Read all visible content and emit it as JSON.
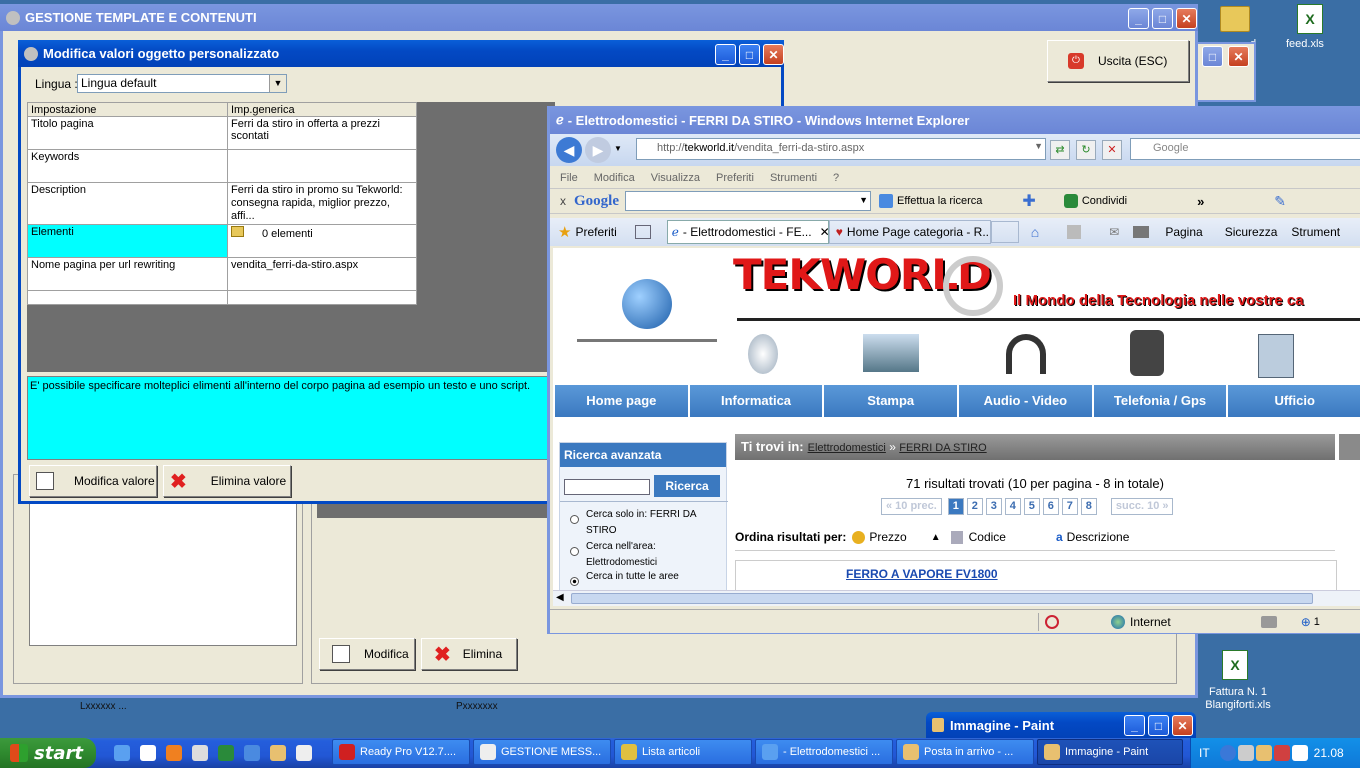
{
  "desktop": {
    "icon1_label": "feed.xls",
    "icon1_partial": "d",
    "icon2_label": "Fattura N. 1 Blangiforti.xls"
  },
  "back_window": {
    "title": "GESTIONE TEMPLATE E CONTENUTI",
    "exit_label": "Uscita (ESC)",
    "modify_label": "Modifica",
    "delete_label": "Elimina",
    "behind_text_left": "Lxxxxxx ...",
    "behind_text_right": "Pxxxxxxx"
  },
  "dialog": {
    "title": "Modifica valori oggetto personalizzato",
    "language_label": "Lingua :",
    "language_value": "Lingua default",
    "grid": {
      "headers": [
        "Impostazione",
        "Imp.generica"
      ],
      "rows": [
        {
          "key": "Titolo pagina",
          "value": "Ferri da stiro in offerta a prezzi scontati"
        },
        {
          "key": "Keywords",
          "value": ""
        },
        {
          "key": "Description",
          "value": "Ferri da stiro in promo su Tekworld: consegna rapida, miglior prezzo, affi..."
        },
        {
          "key": "Elementi",
          "value": "0 elementi"
        },
        {
          "key": "Nome pagina per url rewriting",
          "value": "vendita_ferri-da-stiro.aspx"
        },
        {
          "key": "",
          "value": ""
        }
      ]
    },
    "info_text": "E' possibile specificare molteplici elimenti all'interno del corpo pagina ad esempio un testo e uno script.",
    "modify_value_label": "Modifica valore",
    "delete_value_label": "Elimina valore"
  },
  "ie": {
    "title": "- Elettrodomestici - FERRI DA STIRO - Windows Internet Explorer",
    "address": "http://tekworld.it/vendita_ferri-da-stiro.aspx",
    "address_host": "http://",
    "address_domain": "tekworld.it",
    "address_path": "/vendita_ferri-da-stiro.aspx",
    "search_placeholder": "Google",
    "menu": [
      "File",
      "Modifica",
      "Visualizza",
      "Preferiti",
      "Strumenti",
      "?"
    ],
    "toolbar": {
      "x": "x",
      "google": "Google",
      "search_btn": "Effettua la ricerca",
      "share": "Condividi",
      "more": "»"
    },
    "fav_label": "Preferiti",
    "tab1": "- Elettrodomestici - FE...",
    "tab2": "Home Page categoria - R...",
    "cmd": {
      "page": "Pagina",
      "security": "Sicurezza",
      "tools": "Strument"
    },
    "status_zone": "Internet",
    "status_zoom": "1"
  },
  "site": {
    "logo": "TEKWORLD",
    "tagline": "Il Mondo della Tecnologia nelle vostre ca",
    "nav": [
      "Home page",
      "Informatica",
      "Stampa",
      "Audio - Video",
      "Telefonia / Gps",
      "Ufficio"
    ],
    "search_title": "Ricerca avanzata",
    "search_btn": "Ricerca",
    "radio1": "Cerca solo in: FERRI DA STIRO",
    "radio2": "Cerca nell'area: Elettrodomestici",
    "radio3": "Cerca in tutte le aree",
    "breadcrumb_label": "Ti trovi in:",
    "crumb1": "Elettrodomestici",
    "crumb_sep": "»",
    "crumb2": "FERRI DA STIRO",
    "results": "71 risultati trovati (10 per pagina - 8 in totale)",
    "prev": "« 10 prec.",
    "next": "succ. 10 »",
    "pages": [
      "1",
      "2",
      "3",
      "4",
      "5",
      "6",
      "7",
      "8"
    ],
    "sort_label": "Ordina risultati per:",
    "sort_price": "Prezzo",
    "sort_code": "Codice",
    "sort_desc": "Descrizione",
    "product": "FERRO A VAPORE FV1800"
  },
  "paint": {
    "title": "Immagine - Paint"
  },
  "taskbar": {
    "start": "start",
    "items": [
      "Ready Pro V12.7....",
      "GESTIONE MESS...",
      "Lista articoli",
      "- Elettrodomestici ...",
      "Posta in arrivo - ...",
      "Immagine - Paint"
    ],
    "lang": "IT",
    "clock": "21.08"
  },
  "colors": {
    "cyan": "#00ffff",
    "xp_blue": "#0349c4",
    "nav_blue": "#3b79c0"
  }
}
